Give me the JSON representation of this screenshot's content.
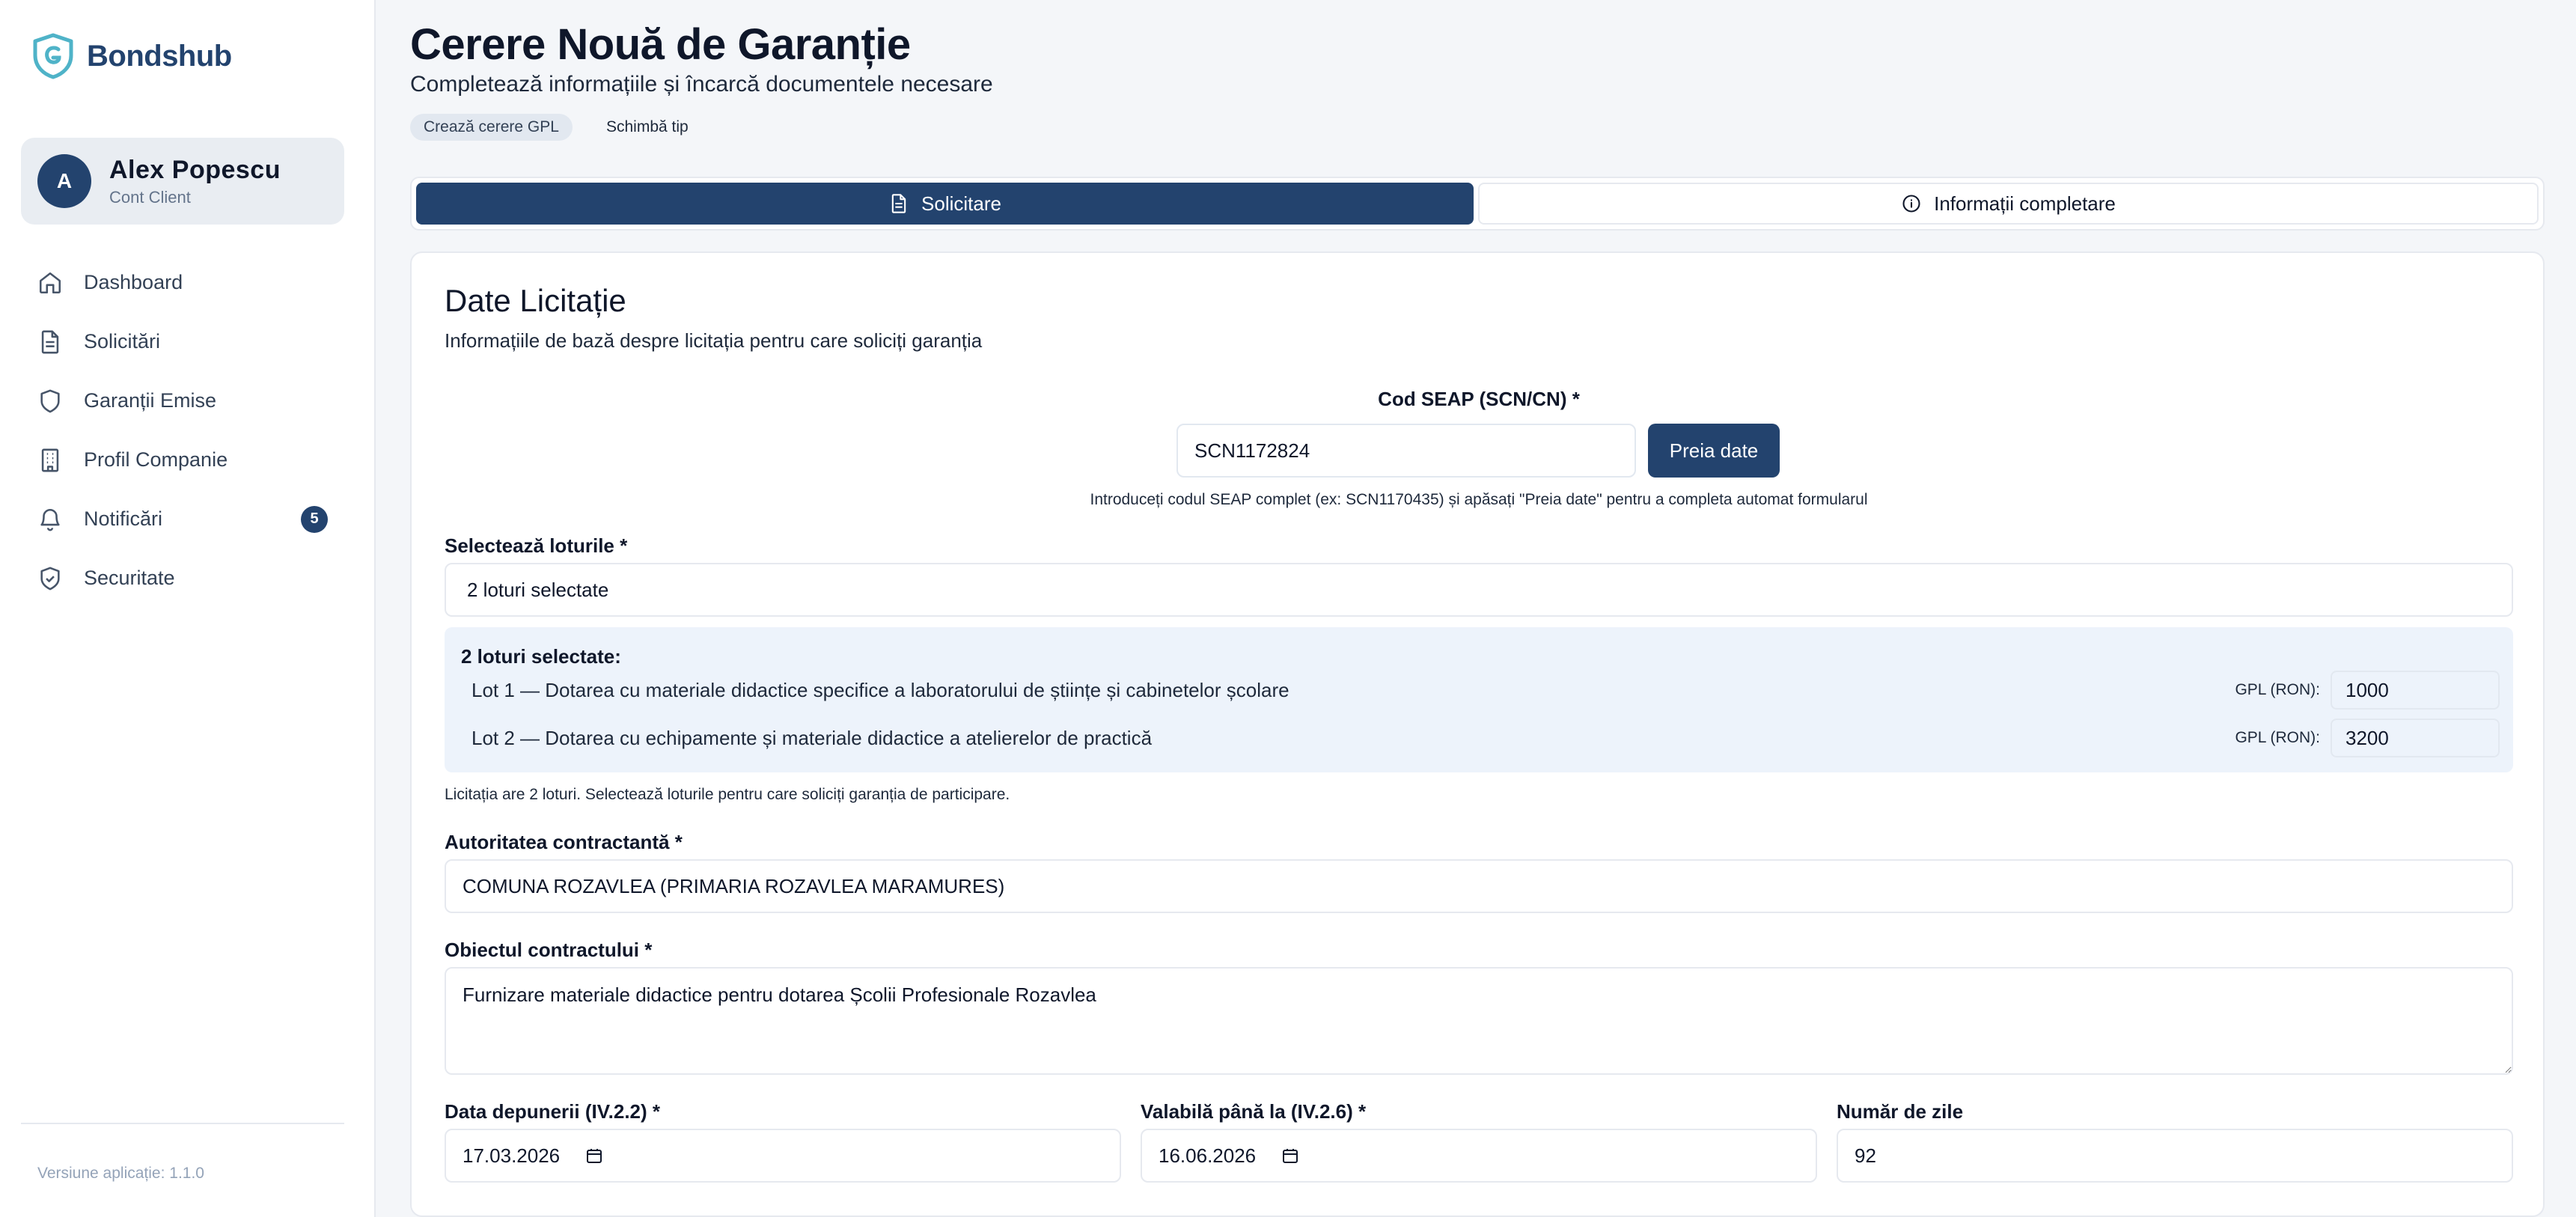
{
  "brand": {
    "name": "Bondshub",
    "logo_icon": "shield-logo-icon",
    "accent": "#23436e",
    "logo_color": "#4fb3c8"
  },
  "user": {
    "initial": "A",
    "name": "Alex Popescu",
    "role": "Cont Client"
  },
  "sidebar": {
    "items": [
      {
        "label": "Dashboard",
        "icon": "home-icon"
      },
      {
        "label": "Solicitări",
        "icon": "document-icon"
      },
      {
        "label": "Garanții Emise",
        "icon": "shield-icon"
      },
      {
        "label": "Profil Companie",
        "icon": "building-icon"
      },
      {
        "label": "Notificări",
        "icon": "bell-icon",
        "badge": "5"
      },
      {
        "label": "Securitate",
        "icon": "shield-check-icon"
      }
    ],
    "version": "Versiune aplicație: 1.1.0"
  },
  "header": {
    "title": "Cerere Nouă de Garanție",
    "subtitle": "Completează informațiile și încarcă documentele necesare",
    "chip": "Crează cerere GPL",
    "change_type": "Schimbă tip"
  },
  "tabs": [
    {
      "label": "Solicitare",
      "icon": "document-icon",
      "active": true
    },
    {
      "label": "Informații completare",
      "icon": "info-icon",
      "active": false
    }
  ],
  "form": {
    "section_title": "Date Licitație",
    "section_desc": "Informațiile de bază despre licitația pentru care soliciți garanția",
    "seap": {
      "label": "Cod SEAP (SCN/CN) *",
      "value": "SCN1172824",
      "button": "Preia date",
      "help": "Introduceți codul SEAP complet (ex: SCN1170435) și apăsați \"Preia date\" pentru a completa automat formularul"
    },
    "lots": {
      "label": "Selectează loturile *",
      "value": "2 loturi selectate",
      "summary_title": "2 loturi selectate:",
      "items": [
        {
          "name": "Lot 1 — Dotarea cu materiale didactice specifice a laboratorului de științe și cabinetelor școlare",
          "gpl_label": "GPL (RON):",
          "gpl": "1000"
        },
        {
          "name": "Lot 2 — Dotarea cu echipamente și materiale didactice a atelierelor de practică",
          "gpl_label": "GPL (RON):",
          "gpl": "3200"
        }
      ],
      "help": "Licitația are 2 loturi. Selectează loturile pentru care soliciți garanția de participare."
    },
    "authority": {
      "label": "Autoritatea contractantă *",
      "value": "COMUNA ROZAVLEA (PRIMARIA ROZAVLEA MARAMURES)"
    },
    "object": {
      "label": "Obiectul contractului *",
      "value": "Furnizare materiale didactice pentru dotarea Școlii Profesionale Rozavlea"
    },
    "submission_date": {
      "label": "Data depunerii (IV.2.2) *",
      "value": "17.03.2026"
    },
    "valid_until": {
      "label": "Valabilă până la (IV.2.6) *",
      "value": "16.06.2026"
    },
    "days": {
      "label": "Număr de zile",
      "value": "92"
    }
  }
}
